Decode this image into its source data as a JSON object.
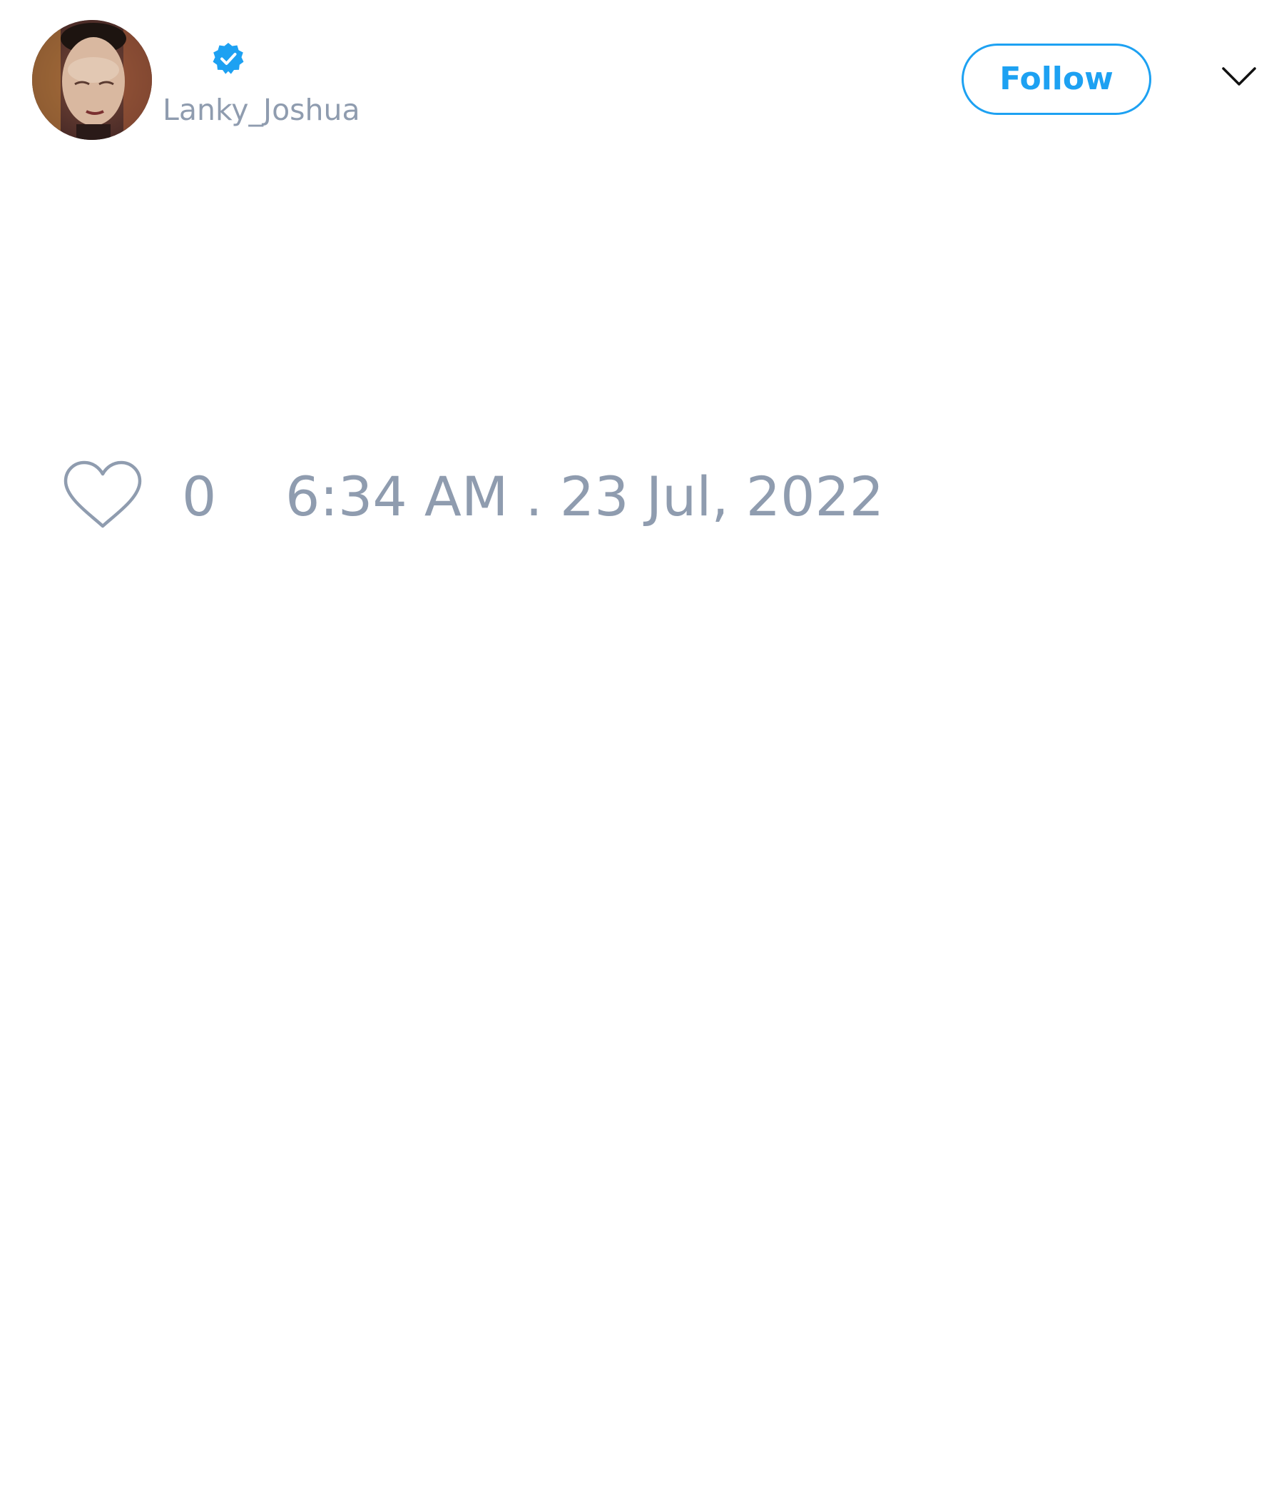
{
  "user": {
    "handle": "Lanky_Joshua",
    "verified": true,
    "avatar_icon": "profile-photo"
  },
  "header": {
    "follow_label": "Follow",
    "menu_icon": "chevron-down-icon"
  },
  "footer": {
    "like_icon": "heart-outline-icon",
    "like_count": "0",
    "timestamp": "6:34 AM . 23 Jul, 2022"
  },
  "colors": {
    "accent": "#1da1f2",
    "muted_text": "#8f9caf",
    "icon_dark": "#111111",
    "background": "#ffffff"
  }
}
